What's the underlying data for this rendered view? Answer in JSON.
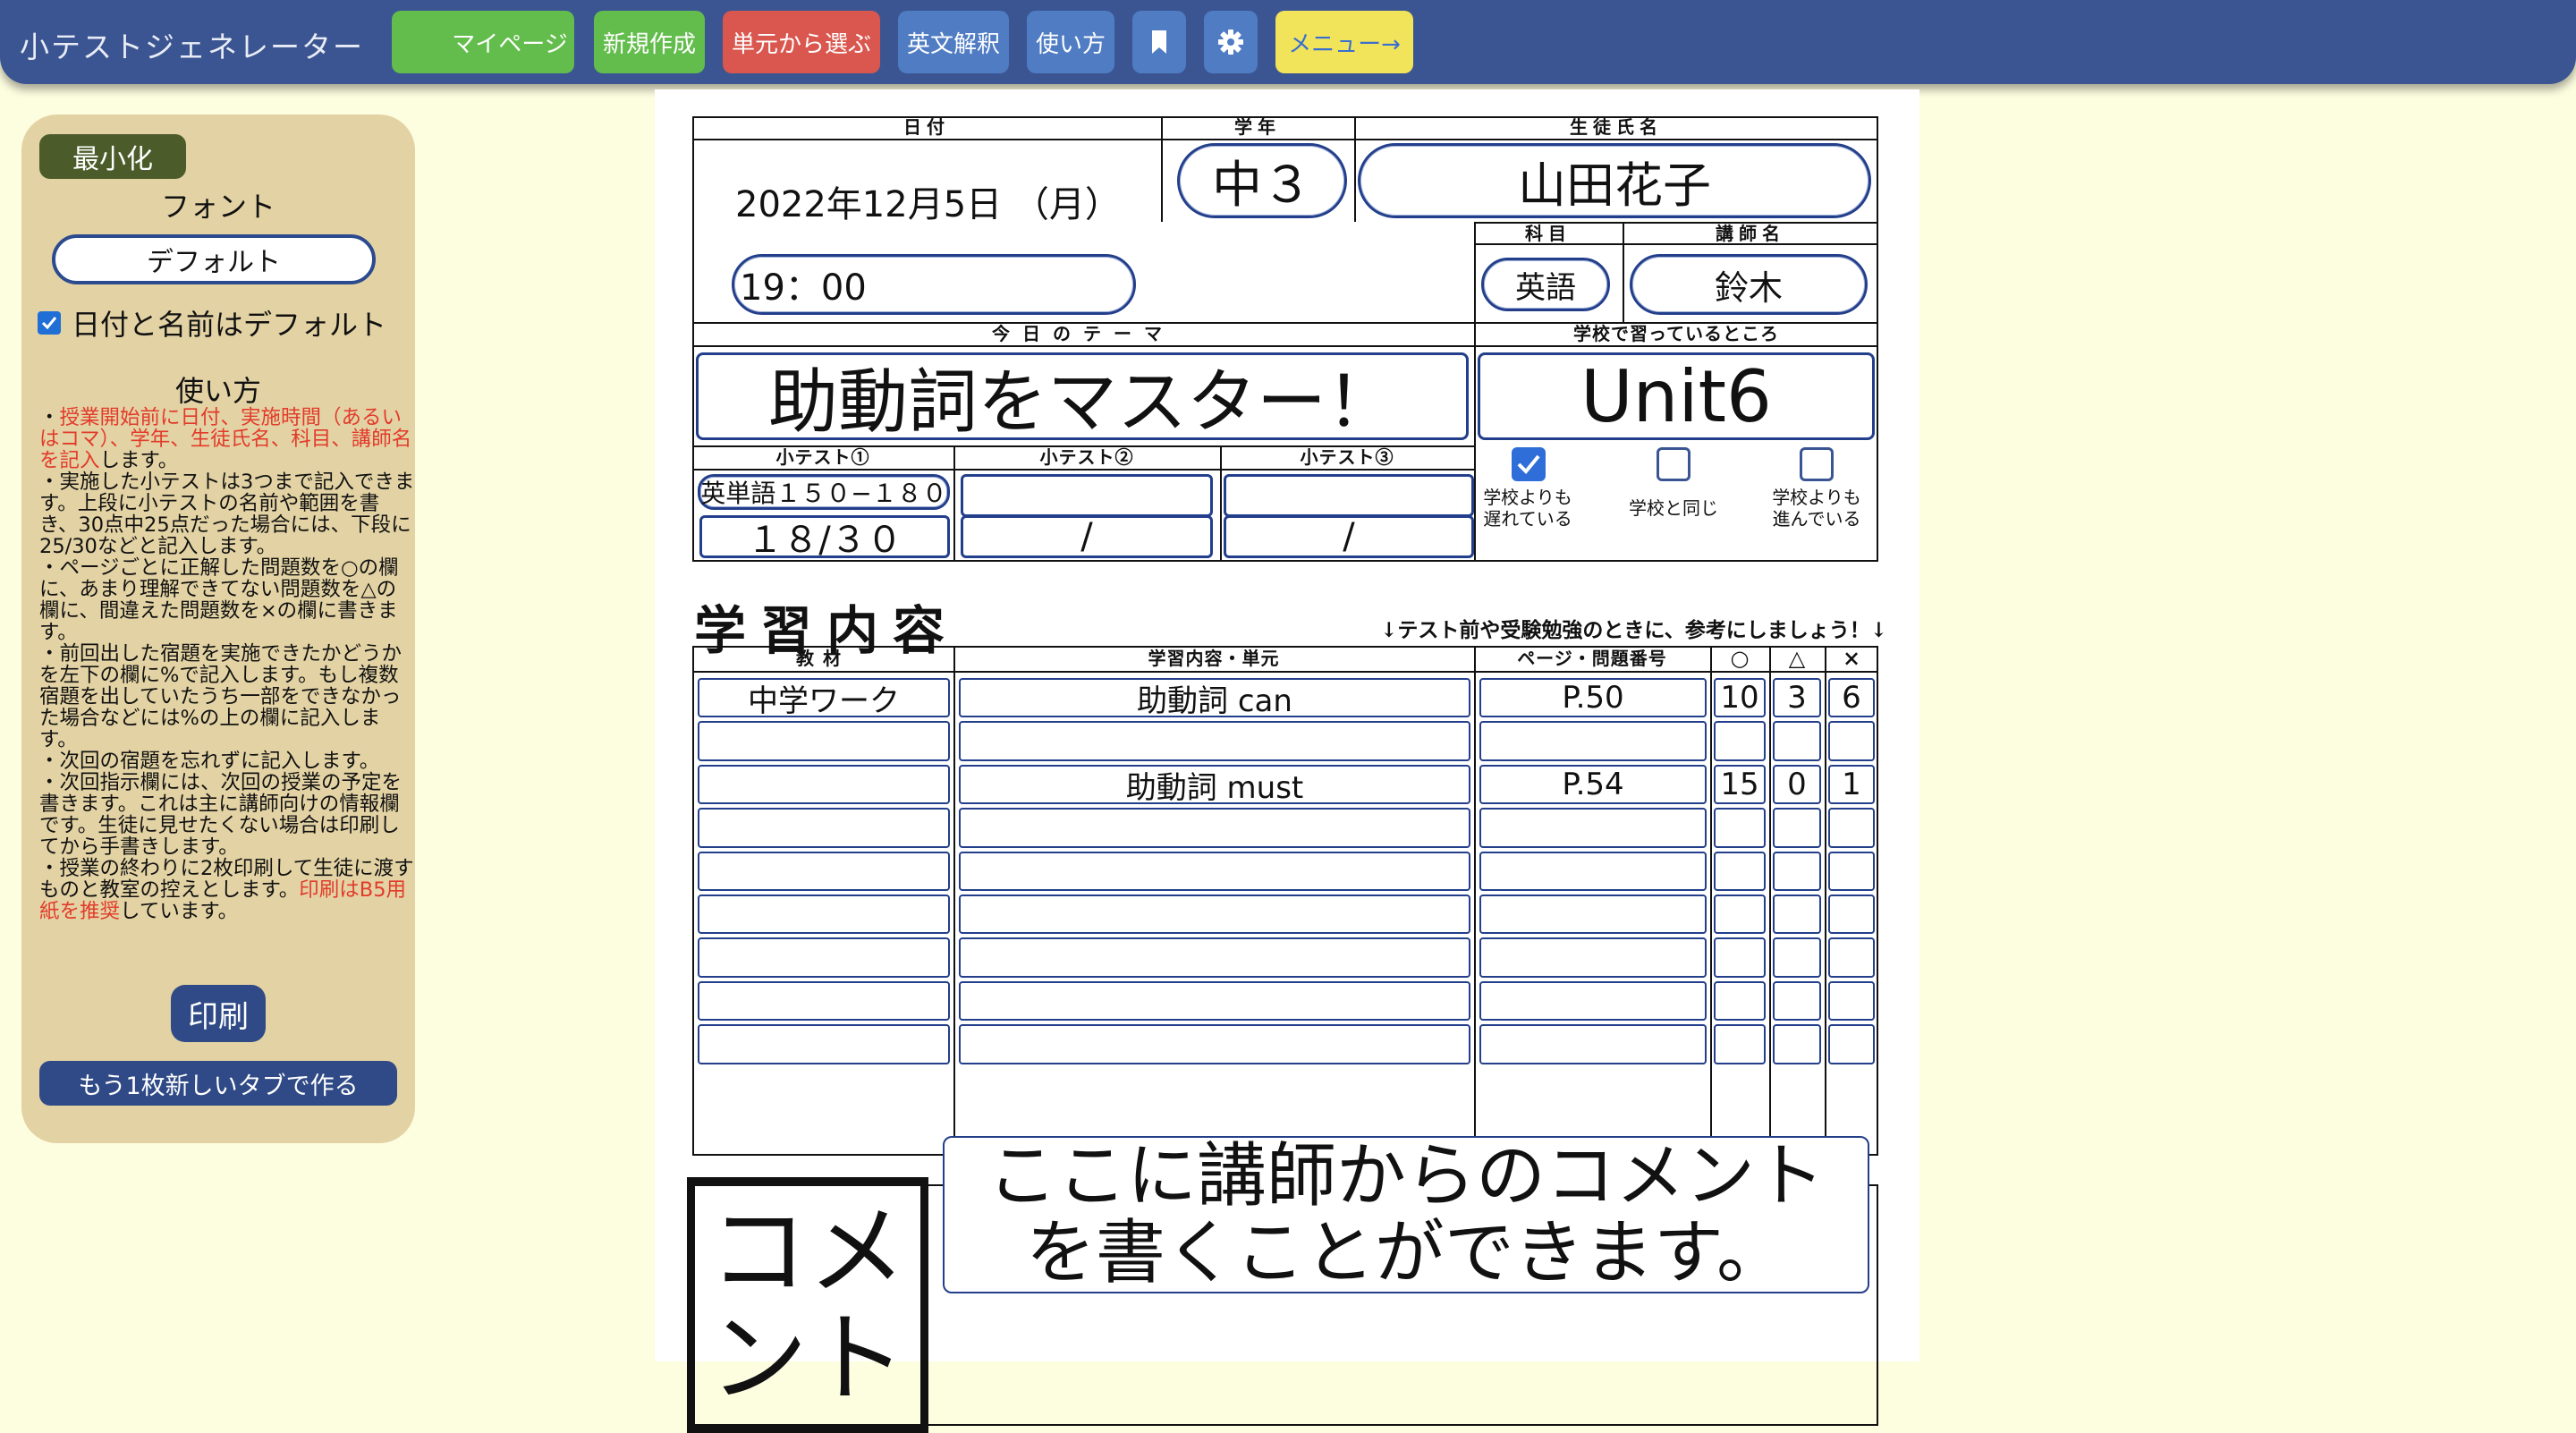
{
  "navbar": {
    "brand": "小テストジェネレーター",
    "buttons": {
      "mypage": "マイページ",
      "new": "新規作成",
      "unit": "単元から選ぶ",
      "translate": "英文解釈",
      "howto": "使い方",
      "menu": "メニュー→"
    },
    "colors": {
      "mypage": "#63bd4c",
      "new": "#63bd4c",
      "unit": "#d9574e",
      "translate": "#4f7cc3",
      "howto": "#4f7cc3",
      "bookmark": "#4f7cc3",
      "settings": "#4f7cc3",
      "menu": "#f2e45a"
    }
  },
  "sidebar": {
    "minimize": "最小化",
    "font_label": "フォント",
    "font_value": "デフォルト",
    "default_check_label": "日付と名前はデフォルト",
    "howto_title": "使い方",
    "instructions": {
      "p1_pre": "・",
      "p1_red": "授業開始前に日付、実施時間（あるいはコマ）、学年、生徒氏名、科目、講師名を記入",
      "p1_post": "します。",
      "p2": "・実施した小テストは3つまで記入できます。上段に小テストの名前や範囲を書き、30点中25点だった場合には、下段に25/30などと記入します。",
      "p3": "・ページごとに正解した問題数を○の欄に、あまり理解できてない問題数を△の欄に、間違えた問題数を×の欄に書きます。",
      "p4": "・前回出した宿題を実施できたかどうかを左下の欄に%で記入します。もし複数宿題を出していたうち一部をできなかった場合などには%の上の欄に記入します。",
      "p5": "・次回の宿題を忘れずに記入します。",
      "p6": "・次回指示欄には、次回の授業の予定を書きます。これは主に講師向けの情報欄です。生徒に見せたくない場合は印刷してから手書きします。",
      "p7_pre": "・授業の終わりに2枚印刷して生徒に渡すものと教室の控えとします。",
      "p7_red": "印刷はB5用紙を推奨",
      "p7_post": "しています。"
    },
    "print": "印刷",
    "new_tab": "もう1枚新しいタブで作る"
  },
  "sheet": {
    "headers": {
      "date": "日付",
      "grade": "学年",
      "student": "生徒氏名",
      "subject": "科目",
      "teacher": "講師名",
      "theme": "今日のテーマ",
      "school_progress": "学校で習っているところ",
      "quiz1": "小テスト①",
      "quiz2": "小テスト②",
      "quiz3": "小テスト③",
      "material": "教材",
      "content": "学習内容・単元",
      "page": "ページ・問題番号",
      "circle": "○",
      "triangle": "△",
      "cross": "×"
    },
    "date": "2022年12月5日 （月）",
    "time": "19：00",
    "grade": "中３",
    "student_name": "山田花子",
    "subject": "英語",
    "teacher_name": "鈴木",
    "theme": "助動詞をマスター！",
    "school_unit": "Unit6",
    "quizzes": [
      {
        "name": "英単語１５０−１８０",
        "score": "１８/３０"
      },
      {
        "name": "",
        "score": "/"
      },
      {
        "name": "",
        "score": "/"
      }
    ],
    "progress_options": [
      {
        "label": "学校よりも遅れている",
        "checked": true
      },
      {
        "label": "学校と同じ",
        "checked": false
      },
      {
        "label": "学校よりも進んでいる",
        "checked": false
      }
    ],
    "study_title": "学習内容",
    "study_note": "↓テスト前や受験勉強のときに、参考にしましょう！↓",
    "rows": [
      {
        "material": "中学ワーク",
        "content": "助動詞 can",
        "page": "P.50",
        "o": "10",
        "t": "3",
        "x": "6"
      },
      {
        "material": "",
        "content": "",
        "page": "",
        "o": "",
        "t": "",
        "x": ""
      },
      {
        "material": "",
        "content": "助動詞 must",
        "page": "P.54",
        "o": "15",
        "t": "0",
        "x": "1"
      },
      {
        "material": "",
        "content": "",
        "page": "",
        "o": "",
        "t": "",
        "x": ""
      },
      {
        "material": "",
        "content": "",
        "page": "",
        "o": "",
        "t": "",
        "x": ""
      },
      {
        "material": "",
        "content": "",
        "page": "",
        "o": "",
        "t": "",
        "x": ""
      },
      {
        "material": "",
        "content": "",
        "page": "",
        "o": "",
        "t": "",
        "x": ""
      },
      {
        "material": "",
        "content": "",
        "page": "",
        "o": "",
        "t": "",
        "x": ""
      },
      {
        "material": "",
        "content": "",
        "page": "",
        "o": "",
        "t": "",
        "x": ""
      }
    ],
    "comment_label": "コメント",
    "comment_text": "ここに講師からのコメントを書くことができます。"
  }
}
